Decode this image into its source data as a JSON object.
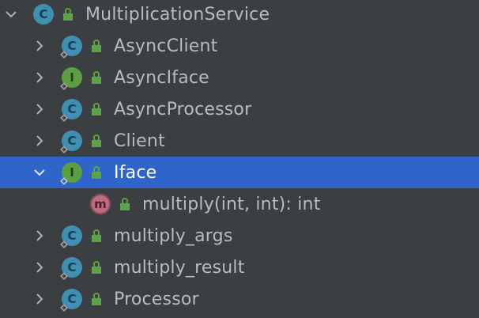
{
  "tree": {
    "root": {
      "label": "MultiplicationService",
      "kind": "C",
      "expanded": true
    },
    "items": [
      {
        "label": "AsyncClient",
        "kind": "C",
        "expanded": false
      },
      {
        "label": "AsyncIface",
        "kind": "I",
        "expanded": false
      },
      {
        "label": "AsyncProcessor",
        "kind": "C",
        "expanded": false
      },
      {
        "label": "Client",
        "kind": "C",
        "expanded": false
      },
      {
        "label": "Iface",
        "kind": "I",
        "expanded": true,
        "selected": true
      },
      {
        "label": "multiply(int, int): int",
        "kind": "m",
        "child_of": "Iface"
      },
      {
        "label": "multiply_args",
        "kind": "C",
        "expanded": false
      },
      {
        "label": "multiply_result",
        "kind": "C",
        "expanded": false
      },
      {
        "label": "Processor",
        "kind": "C",
        "expanded": false
      }
    ]
  },
  "colors": {
    "background": "#3c3f41",
    "selection": "#2f65ca",
    "text": "#bbbbbb",
    "selected_text": "#ffffff",
    "class_icon": "#3f8fb1",
    "interface_icon": "#5b9e43",
    "method_icon": "#d9748c",
    "lock": "#5aa346"
  }
}
